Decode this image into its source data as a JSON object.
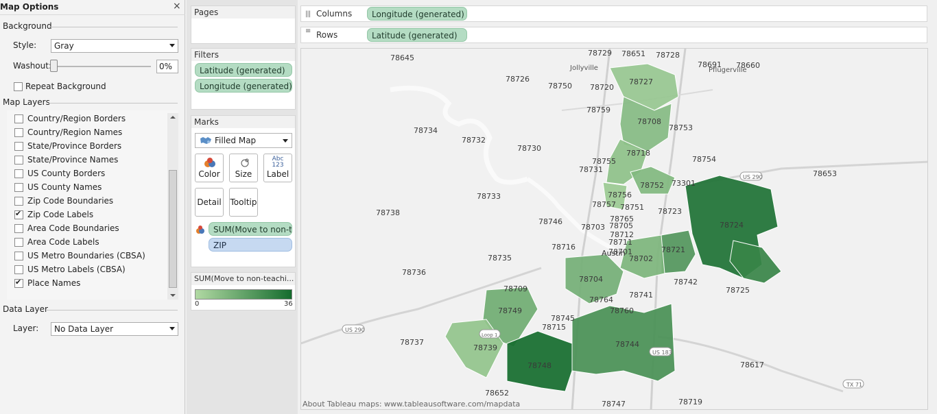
{
  "map_options": {
    "title": "Map Options",
    "close": "×",
    "background": {
      "heading": "Background",
      "style_label": "Style:",
      "style_value": "Gray",
      "washout_label": "Washout:",
      "washout_value": "0%",
      "washout_level": 0,
      "repeat_label": "Repeat Background",
      "repeat_checked": false
    },
    "map_layers": {
      "heading": "Map Layers",
      "items": [
        {
          "label": "Country/Region Borders",
          "checked": false
        },
        {
          "label": "Country/Region Names",
          "checked": false
        },
        {
          "label": "State/Province Borders",
          "checked": false
        },
        {
          "label": "State/Province Names",
          "checked": false
        },
        {
          "label": "US County Borders",
          "checked": false
        },
        {
          "label": "US County Names",
          "checked": false
        },
        {
          "label": "Zip Code Boundaries",
          "checked": false
        },
        {
          "label": "Zip Code Labels",
          "checked": true
        },
        {
          "label": "Area Code Boundaries",
          "checked": false
        },
        {
          "label": "Area Code Labels",
          "checked": false
        },
        {
          "label": "US Metro Boundaries (CBSA)",
          "checked": false
        },
        {
          "label": "US Metro Labels (CBSA)",
          "checked": false
        },
        {
          "label": "Place Names",
          "checked": true
        }
      ]
    },
    "data_layer": {
      "heading": "Data Layer",
      "layer_label": "Layer:",
      "layer_value": "No Data Layer"
    }
  },
  "shelves": {
    "pages_title": "Pages",
    "filters_title": "Filters",
    "filters": [
      "Latitude (generated)",
      "Longitude (generated)"
    ],
    "marks_title": "Marks",
    "mark_type": "Filled Map",
    "buttons": {
      "color": "Color",
      "size": "Size",
      "label": "Label",
      "detail": "Detail",
      "tooltip": "Tooltip",
      "label_glyph_top": "Abc",
      "label_glyph_bottom": "123"
    },
    "color_field": "SUM(Move to non-t..",
    "detail_field": "ZIP",
    "columns_label": "Columns",
    "columns_field": "Longitude (generated)",
    "rows_label": "Rows",
    "rows_field": "Latitude (generated)"
  },
  "legend": {
    "title": "SUM(Move to non-teachi...",
    "min": "0",
    "max": "36",
    "color_low": "#b1d9a3",
    "color_high": "#156c2e"
  },
  "map": {
    "attribution": "About Tableau maps: www.tableausoftware.com/mapdata",
    "place_names": [
      "Jollyville",
      "Pflugerville",
      "Austin"
    ],
    "highway_shields": [
      "US 290",
      "US 290",
      "US 183",
      "TX 71",
      "Loop 1"
    ],
    "zip_labels": [
      "78729",
      "78651",
      "78728",
      "78645",
      "78691",
      "78660",
      "78726",
      "78750",
      "78720",
      "78727",
      "78759",
      "78708",
      "78753",
      "78734",
      "78732",
      "78730",
      "78718",
      "78754",
      "78653",
      "78755",
      "78731",
      "78752",
      "73301",
      "78756",
      "78757",
      "78733",
      "78751",
      "78723",
      "78738",
      "78746",
      "78765",
      "78703",
      "78705",
      "78724",
      "78712",
      "78716",
      "78711",
      "78721",
      "78735",
      "78701",
      "78702",
      "78736",
      "78704",
      "78742",
      "78725",
      "78709",
      "78741",
      "78764",
      "78749",
      "78760",
      "78745",
      "78715",
      "78737",
      "78739",
      "78744",
      "78748",
      "78617",
      "78652",
      "78747",
      "78719"
    ],
    "filled_zips": [
      {
        "zip": "78727",
        "value": 6
      },
      {
        "zip": "78708",
        "value": 10
      },
      {
        "zip": "78718",
        "value": 8
      },
      {
        "zip": "78752",
        "value": 11
      },
      {
        "zip": "78757",
        "value": 5
      },
      {
        "zip": "78724",
        "value": 34
      },
      {
        "zip": "78721",
        "value": 22
      },
      {
        "zip": "78702",
        "value": 12
      },
      {
        "zip": "78704",
        "value": 14
      },
      {
        "zip": "78749",
        "value": 15
      },
      {
        "zip": "78739",
        "value": 7
      },
      {
        "zip": "78748",
        "value": 36
      },
      {
        "zip": "78744",
        "value": 24
      },
      {
        "zip": "78725",
        "value": 28
      }
    ]
  }
}
